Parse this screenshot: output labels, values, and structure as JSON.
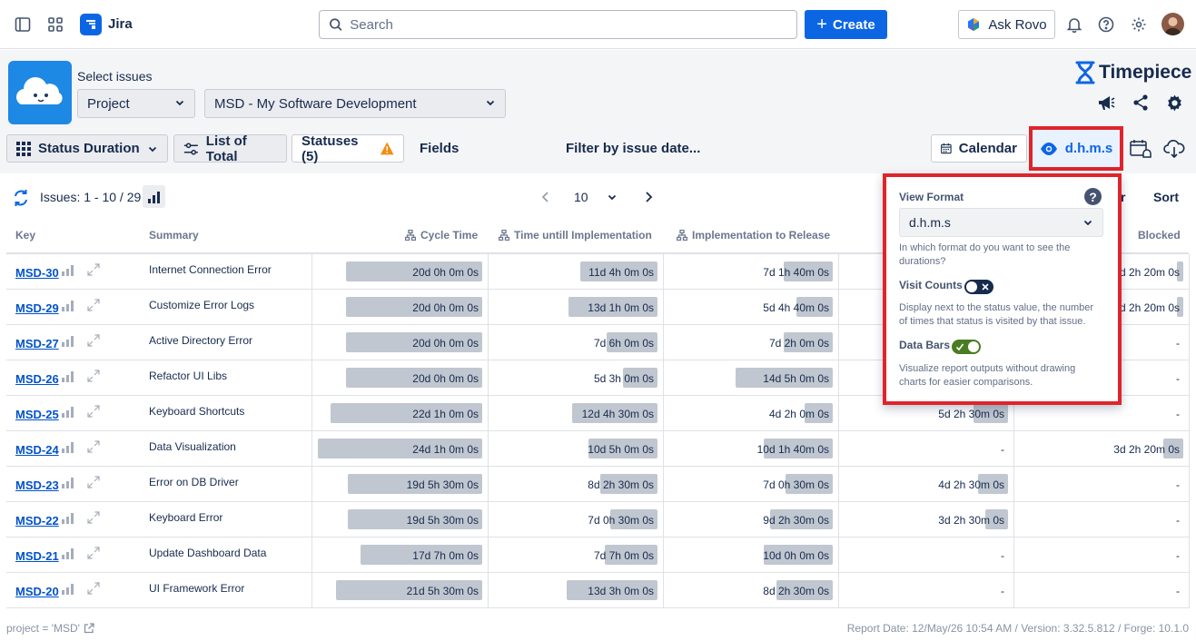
{
  "nav": {
    "app_name": "Jira",
    "search_placeholder": "Search",
    "create_label": "Create",
    "rovo_label": "Ask Rovo"
  },
  "header": {
    "select_issues_label": "Select issues",
    "project_type": "Project",
    "project_value": "MSD - My Software Development",
    "brand": "Timepiece"
  },
  "toolbar": {
    "status_duration": "Status Duration",
    "list_of_total": "List of Total",
    "statuses": "Statuses (5)",
    "fields": "Fields",
    "filter": "Filter by issue date...",
    "calendar": "Calendar",
    "format": "d.h.m.s"
  },
  "pager": {
    "issues": "Issues: 1 - 10 / 29",
    "per_page": "10",
    "partial_label": "r",
    "sort": "Sort"
  },
  "columns": {
    "key": "Key",
    "summary": "Summary",
    "cycle": "Cycle Time",
    "impl": "Time untill Implementation",
    "release": "Implementation to Release",
    "blocked": "Blocked"
  },
  "rows": [
    {
      "key": "MSD-30",
      "summary": "Internet Connection Error",
      "c1": "20d 0h 0m 0s",
      "c2": "11d 4h 0m 0s",
      "c3": "7d 1h 40m 0s",
      "c4": "",
      "c5": "d 2h 20m 0s"
    },
    {
      "key": "MSD-29",
      "summary": "Customize Error Logs",
      "c1": "20d 0h 0m 0s",
      "c2": "13d 1h 0m 0s",
      "c3": "5d 4h 40m 0s",
      "c4": "",
      "c5": "d 2h 20m 0s"
    },
    {
      "key": "MSD-27",
      "summary": "Active Directory Error",
      "c1": "20d 0h 0m 0s",
      "c2": "7d 6h 0m 0s",
      "c3": "7d 2h 0m 0s",
      "c4": "",
      "c5": "-"
    },
    {
      "key": "MSD-26",
      "summary": "Refactor UI Libs",
      "c1": "20d 0h 0m 0s",
      "c2": "5d 3h 0m 0s",
      "c3": "14d 5h 0m 0s",
      "c4": "",
      "c5": "-"
    },
    {
      "key": "MSD-25",
      "summary": "Keyboard Shortcuts",
      "c1": "22d 1h 0m 0s",
      "c2": "12d 4h 30m 0s",
      "c3": "4d 2h 0m 0s",
      "c4": "5d 2h 30m 0s",
      "c5": "-"
    },
    {
      "key": "MSD-24",
      "summary": "Data Visualization",
      "c1": "24d 1h 0m 0s",
      "c2": "10d 5h 0m 0s",
      "c3": "10d 1h 40m 0s",
      "c4": "-",
      "c5": "3d 2h 20m 0s"
    },
    {
      "key": "MSD-23",
      "summary": "Error on DB Driver",
      "c1": "19d 5h 30m 0s",
      "c2": "8d 2h 30m 0s",
      "c3": "7d 0h 30m 0s",
      "c4": "4d 2h 30m 0s",
      "c5": "-"
    },
    {
      "key": "MSD-22",
      "summary": "Keyboard Error",
      "c1": "19d 5h 30m 0s",
      "c2": "7d 0h 30m 0s",
      "c3": "9d 2h 30m 0s",
      "c4": "3d 2h 30m 0s",
      "c5": "-"
    },
    {
      "key": "MSD-21",
      "summary": "Update Dashboard Data",
      "c1": "17d 7h 0m 0s",
      "c2": "7d 7h 0m 0s",
      "c3": "10d 0h 0m 0s",
      "c4": "-",
      "c5": "-"
    },
    {
      "key": "MSD-20",
      "summary": "UI Framework Error",
      "c1": "21d 5h 30m 0s",
      "c2": "13d 3h 0m 0s",
      "c3": "8d 2h 30m 0s",
      "c4": "-",
      "c5": "-"
    }
  ],
  "bars": [
    {
      "c1": 0.83,
      "c2": 0.47,
      "c3": 0.3,
      "c4": 0,
      "c5": 0.04
    },
    {
      "c1": 0.83,
      "c2": 0.54,
      "c3": 0.22,
      "c4": 0,
      "c5": 0.04
    },
    {
      "c1": 0.83,
      "c2": 0.31,
      "c3": 0.3,
      "c4": 0,
      "c5": 0
    },
    {
      "c1": 0.83,
      "c2": 0.21,
      "c3": 0.59,
      "c4": 0,
      "c5": 0
    },
    {
      "c1": 0.92,
      "c2": 0.52,
      "c3": 0.17,
      "c4": 0.21,
      "c5": 0
    },
    {
      "c1": 1.0,
      "c2": 0.42,
      "c3": 0.42,
      "c4": 0,
      "c5": 0.12
    },
    {
      "c1": 0.82,
      "c2": 0.35,
      "c3": 0.29,
      "c4": 0.18,
      "c5": 0
    },
    {
      "c1": 0.82,
      "c2": 0.29,
      "c3": 0.38,
      "c4": 0.14,
      "c5": 0
    },
    {
      "c1": 0.74,
      "c2": 0.32,
      "c3": 0.42,
      "c4": 0,
      "c5": 0
    },
    {
      "c1": 0.89,
      "c2": 0.55,
      "c3": 0.34,
      "c4": 0,
      "c5": 0
    }
  ],
  "popover": {
    "view_format_label": "View Format",
    "view_format_value": "d.h.m.s",
    "view_format_help": "In which format do you want to see the durations?",
    "visit_counts_label": "Visit Counts",
    "visit_counts_on": false,
    "visit_counts_help": "Display next to the status value, the number of times that status is visited by that issue.",
    "data_bars_label": "Data Bars",
    "data_bars_on": true,
    "data_bars_help": "Visualize report outputs without drawing charts for easier comparisons."
  },
  "footer": {
    "jql": "project = 'MSD'",
    "report": "Report Date: 12/May/26 10:54 AM / Version: 3.32.5.812 / Forge: 10.1.0"
  },
  "colors": {
    "accent": "#0c66e4",
    "highlight": "#e0242b",
    "bar": "#c1c7d0",
    "toggle_on": "#4a7c23"
  }
}
